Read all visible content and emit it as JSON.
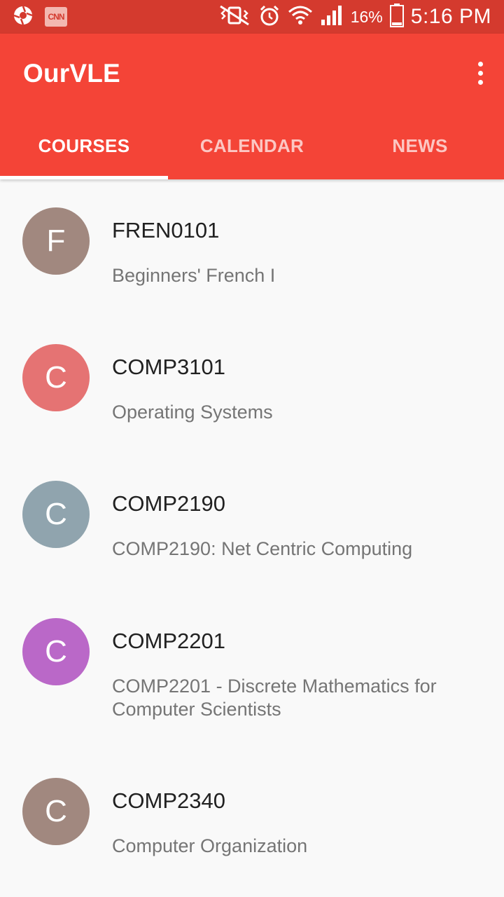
{
  "status_bar": {
    "icons_left": [
      "camera-shutter-icon",
      "cnn-icon"
    ],
    "cnn_label": "CNN",
    "icons_right": [
      "vibrate-icon",
      "alarm-icon",
      "wifi-icon",
      "signal-icon",
      "battery-icon"
    ],
    "battery": "16%",
    "time": "5:16 PM"
  },
  "app_bar": {
    "title": "OurVLE",
    "menu_icon": "more-vertical-icon"
  },
  "tabs": [
    {
      "label": "COURSES",
      "active": true
    },
    {
      "label": "CALENDAR",
      "active": false
    },
    {
      "label": "NEWS",
      "active": false
    }
  ],
  "courses": [
    {
      "initial": "F",
      "code": "FREN0101",
      "name": "Beginners' French I",
      "color": "#a1887f"
    },
    {
      "initial": "C",
      "code": "COMP3101",
      "name": "Operating Systems",
      "color": "#e57373"
    },
    {
      "initial": "C",
      "code": "COMP2190",
      "name": "COMP2190: Net Centric Computing",
      "color": "#90a4ae"
    },
    {
      "initial": "C",
      "code": "COMP2201",
      "name": "COMP2201 - Discrete Mathematics for Computer Scientists",
      "color": "#ba68c8"
    },
    {
      "initial": "C",
      "code": "COMP2340",
      "name": "Computer Organization",
      "color": "#a1887f"
    }
  ]
}
